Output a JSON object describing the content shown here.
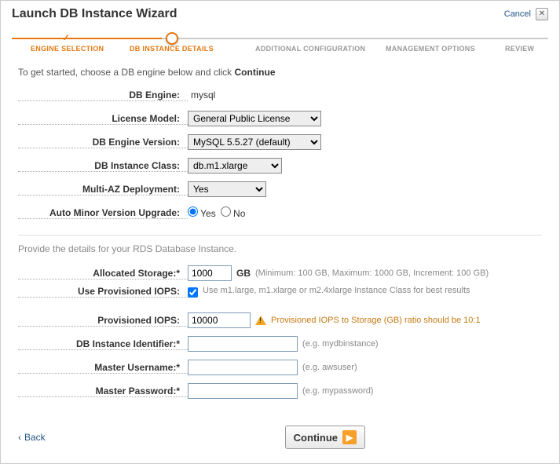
{
  "header": {
    "title": "Launch DB Instance Wizard",
    "cancel": "Cancel"
  },
  "steps": {
    "s1": "ENGINE SELECTION",
    "s2": "DB INSTANCE DETAILS",
    "s3": "ADDITIONAL CONFIGURATION",
    "s4": "MANAGEMENT OPTIONS",
    "s5": "REVIEW"
  },
  "intro": {
    "text": "To get started, choose a DB engine below and click ",
    "bold": "Continue"
  },
  "fields": {
    "engine": {
      "label": "DB Engine:",
      "value": "mysql"
    },
    "license": {
      "label": "License Model:",
      "value": "General Public License"
    },
    "version": {
      "label": "DB Engine Version:",
      "value": "MySQL 5.5.27 (default)"
    },
    "class": {
      "label": "DB Instance Class:",
      "value": "db.m1.xlarge"
    },
    "multiaz": {
      "label": "Multi-AZ Deployment:",
      "value": "Yes"
    },
    "autoupgrade": {
      "label": "Auto Minor Version Upgrade:",
      "yes": "Yes",
      "no": "No"
    }
  },
  "section_note": "Provide the details for your RDS Database Instance.",
  "storage": {
    "label": "Allocated Storage:*",
    "value": "1000",
    "unit": "GB",
    "hint": "(Minimum: 100 GB, Maximum: 1000 GB, Increment: 100 GB)"
  },
  "piops_chk": {
    "label": "Use Provisioned IOPS:",
    "hint": "Use m1.large, m1.xlarge or m2.4xlarge Instance Class for best results"
  },
  "piops": {
    "label": "Provisioned IOPS:",
    "value": "10000",
    "warn": "Provisioned IOPS to Storage (GB) ratio should be 10:1"
  },
  "identifier": {
    "label": "DB Instance Identifier:*",
    "hint": "(e.g. mydbinstance)"
  },
  "username": {
    "label": "Master Username:*",
    "hint": "(e.g. awsuser)"
  },
  "password": {
    "label": "Master Password:*",
    "hint": "(e.g. mypassword)"
  },
  "footer": {
    "back": "Back",
    "continue": "Continue"
  }
}
